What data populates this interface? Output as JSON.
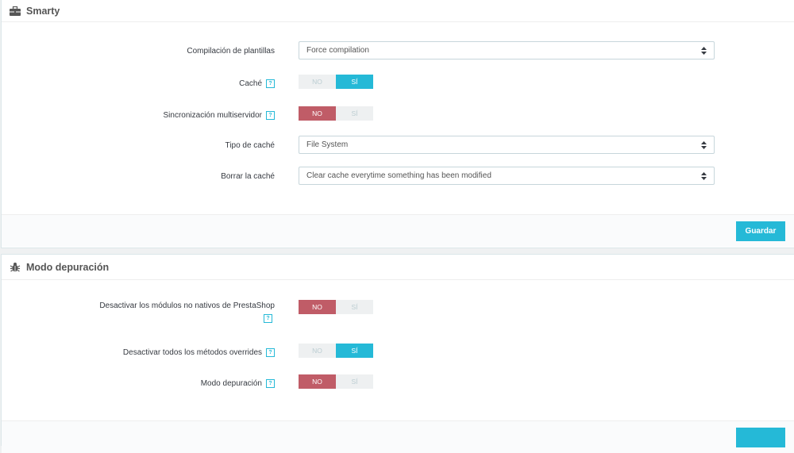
{
  "smarty": {
    "title": "Smarty",
    "icon": "briefcase-icon",
    "template_compilation": {
      "label": "Compilación de plantillas",
      "value": "Force compilation"
    },
    "cache": {
      "label": "Caché",
      "help": "?",
      "no": "NO",
      "yes": "SÍ",
      "active": "yes"
    },
    "multi_front_sync": {
      "label": "Sincronización multiservidor",
      "help": "?",
      "no": "NO",
      "yes": "SÍ",
      "active": "no"
    },
    "cache_type": {
      "label": "Tipo de caché",
      "value": "File System"
    },
    "clear_cache": {
      "label": "Borrar la caché",
      "value": "Clear cache everytime something has been modified"
    },
    "save_label": "Guardar"
  },
  "debug": {
    "title": "Modo depuración",
    "icon": "bug-icon",
    "disable_non_native": {
      "label": "Desactivar los módulos no nativos de PrestaShop",
      "help": "?",
      "no": "NO",
      "yes": "SÍ",
      "active": "no"
    },
    "disable_overrides": {
      "label": "Desactivar todos los métodos overrides",
      "help": "?",
      "no": "NO",
      "yes": "SÍ",
      "active": "yes"
    },
    "debug_mode": {
      "label": "Modo depuración",
      "help": "?",
      "no": "NO",
      "yes": "SÍ",
      "active": "no"
    }
  },
  "colors": {
    "accent": "#25b9d7",
    "danger": "#c05c67"
  }
}
